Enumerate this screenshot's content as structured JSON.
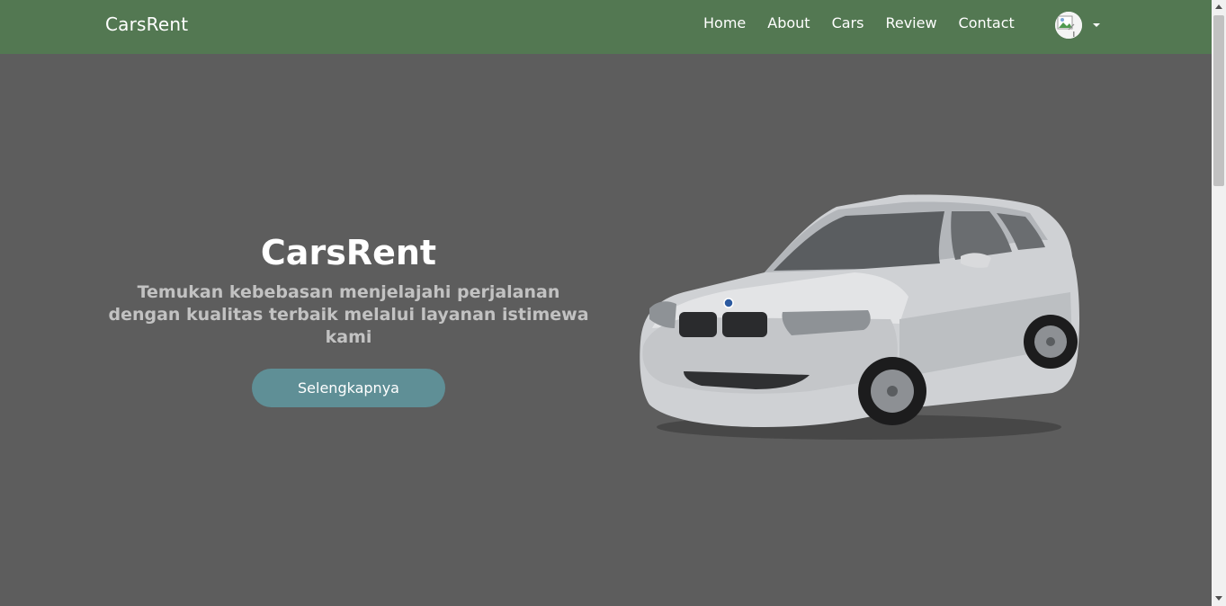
{
  "navbar": {
    "brand": "CarsRent",
    "links": [
      "Home",
      "About",
      "Cars",
      "Review",
      "Contact"
    ],
    "profile_icon": "avatar-image-icon"
  },
  "hero": {
    "title": "CarsRent",
    "subtitle": "Temukan kebebasan menjelajahi perjalanan dengan kualitas terbaik melalui layanan istimewa kami",
    "button_label": "Selengkapnya",
    "image_icon": "car-image"
  },
  "colors": {
    "navbar_bg": "#537852",
    "page_bg": "#5d5d5d",
    "button_bg": "#5f8f96",
    "subtitle_text": "#c2c2c2"
  }
}
